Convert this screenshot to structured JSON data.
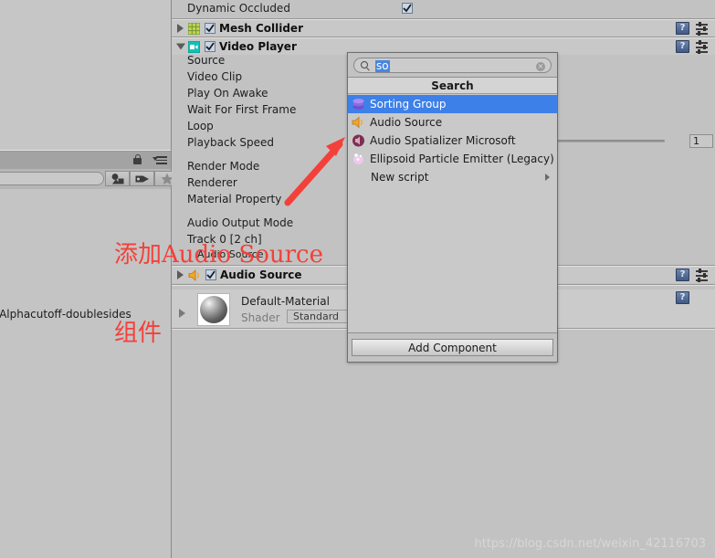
{
  "window": {
    "bg_color": "#c2c2c2",
    "accent_blue": "#3d80e8",
    "annotation_color": "#f4403a"
  },
  "left_panel": {
    "search_placeholder": "",
    "asset_label": "ed-Alphacutoff-doublesides",
    "toolbar_buttons": [
      {
        "name": "scene-vis-button",
        "icon": "shapes-icon"
      },
      {
        "name": "tag-button",
        "icon": "tag-icon"
      },
      {
        "name": "favorite-button",
        "icon": "star-icon"
      }
    ],
    "lock_icon": "lock-icon",
    "menu_icon": "hamburger-menu-icon"
  },
  "inspector": {
    "top_property": {
      "label": "Dynamic Occluded",
      "checked": true
    },
    "components": [
      {
        "name": "Mesh Collider",
        "enabled": true,
        "expanded": false,
        "icon": "mesh-collider-icon"
      },
      {
        "name": "Video Player",
        "enabled": true,
        "expanded": true,
        "icon": "video-player-icon",
        "properties": [
          "Source",
          "Video Clip",
          "Play On Awake",
          "Wait For First Frame",
          "Loop",
          "Playback Speed",
          "Render Mode",
          "Renderer",
          "Material Property",
          "Audio Output Mode",
          "Track 0 [2 ch]",
          "Audio Source"
        ],
        "speed_value": "1"
      },
      {
        "name": "Audio Source",
        "enabled": true,
        "expanded": false,
        "icon": "audio-source-icon"
      }
    ],
    "material": {
      "name": "Default-Material",
      "shader_label": "Shader",
      "shader_value": "Standard"
    },
    "icons": {
      "help": "help-book-icon",
      "settings": "settings-sliders-icon"
    }
  },
  "add_component_popup": {
    "search_value": "so",
    "search_icon": "search-icon",
    "clear_icon": "clear-circle-icon",
    "header": "Search",
    "items": [
      {
        "label": "Sorting Group",
        "icon": "sorting-group-icon",
        "selected": true,
        "submenu": false
      },
      {
        "label": "Audio Source",
        "icon": "audio-source-icon",
        "selected": false,
        "submenu": false
      },
      {
        "label": "Audio Spatializer Microsoft",
        "icon": "audio-spatializer-icon",
        "selected": false,
        "submenu": false
      },
      {
        "label": "Ellipsoid Particle Emitter (Legacy)",
        "icon": "particle-emitter-icon",
        "selected": false,
        "submenu": false
      },
      {
        "label": "New script",
        "icon": null,
        "selected": false,
        "submenu": true
      }
    ],
    "add_component_label": "Add Component"
  },
  "annotations": {
    "line1": "添加Audio Source",
    "line2": "组件",
    "arrow": "red-arrow-pointing-to-audio-source"
  },
  "watermark": "https://blog.csdn.net/weixin_42116703"
}
